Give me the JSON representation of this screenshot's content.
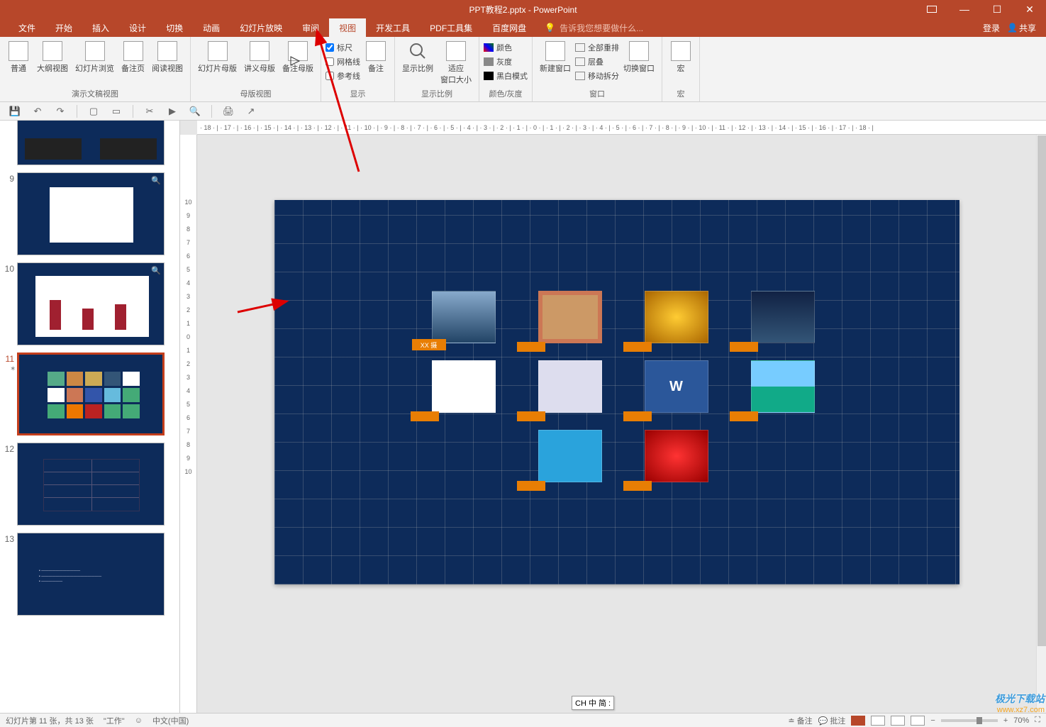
{
  "app": {
    "title": "PPT教程2.pptx - PowerPoint"
  },
  "winbtns": {
    "min": "—",
    "max": "☐",
    "close": "✕",
    "ribtoggle": "▭"
  },
  "menu": {
    "file": "文件",
    "home": "开始",
    "insert": "插入",
    "design": "设计",
    "transition": "切换",
    "animation": "动画",
    "slideshow": "幻灯片放映",
    "review": "审阅",
    "view": "视图",
    "developer": "开发工具",
    "pdf": "PDF工具集",
    "baidu": "百度网盘",
    "tellme": "告诉我您想要做什么...",
    "login": "登录",
    "share": "共享"
  },
  "ribbon": {
    "g1": {
      "label": "演示文稿视图",
      "normal": "普通",
      "outline": "大纲视图",
      "sorter": "幻灯片浏览",
      "notes": "备注页",
      "reading": "阅读视图"
    },
    "g2": {
      "label": "母版视图",
      "slideMaster": "幻灯片母版",
      "handoutMaster": "讲义母版",
      "notesMaster": "备注母版"
    },
    "g3": {
      "label": "显示",
      "ruler": "标尺",
      "gridlines": "网格线",
      "guides": "参考线",
      "notes": "备注"
    },
    "g4": {
      "label": "显示比例",
      "zoom": "显示比例",
      "fit": "适应\n窗口大小"
    },
    "g5": {
      "label": "颜色/灰度",
      "color": "颜色",
      "gray": "灰度",
      "bw": "黑白模式"
    },
    "g6": {
      "label": "窗口",
      "newwin": "新建窗口",
      "arrange": "全部重排",
      "cascade": "层叠",
      "split": "移动拆分",
      "switch": "切换窗口"
    },
    "g7": {
      "label": "宏",
      "macro": "宏"
    }
  },
  "ruler": {
    "h": "· 18 · | · 17 · | · 16 · | · 15 · | · 14 · | · 13 · | · 12 · | · 11 · | · 10 · | · 9 · | · 8 · | · 7 · | · 6 · | · 5 · | · 4 · | · 3 · | · 2 · | · 1 · | · 0 · | · 1 · | · 2 · | · 3 · | · 4 · | · 5 · | · 6 · | · 7 · | · 8 · | · 9 · | · 10 · | · 11 · | · 12 · | · 13 · | · 14 · | · 15 · | · 16 · | · 17 · | · 18 · |",
    "v": [
      "10",
      "9",
      "8",
      "7",
      "6",
      "5",
      "4",
      "3",
      "2",
      "1",
      "0",
      "1",
      "2",
      "3",
      "4",
      "5",
      "6",
      "7",
      "8",
      "9",
      "10"
    ]
  },
  "slides": {
    "n9": "9",
    "n10": "10",
    "n11": "11",
    "n12": "12",
    "n13": "13"
  },
  "canvas": {
    "xxlabel": "XX 摄"
  },
  "status": {
    "slideinfo": "幻灯片第 11 张，共 13 张",
    "theme": "\"工作\"",
    "lang": "中文(中国)",
    "notes": "备注",
    "comments": "批注",
    "zoom": "70%"
  },
  "ime": {
    "text": "CH 中 简 :"
  },
  "watermark": {
    "line1": "极光下载站",
    "line2": "www.xz7.com"
  }
}
